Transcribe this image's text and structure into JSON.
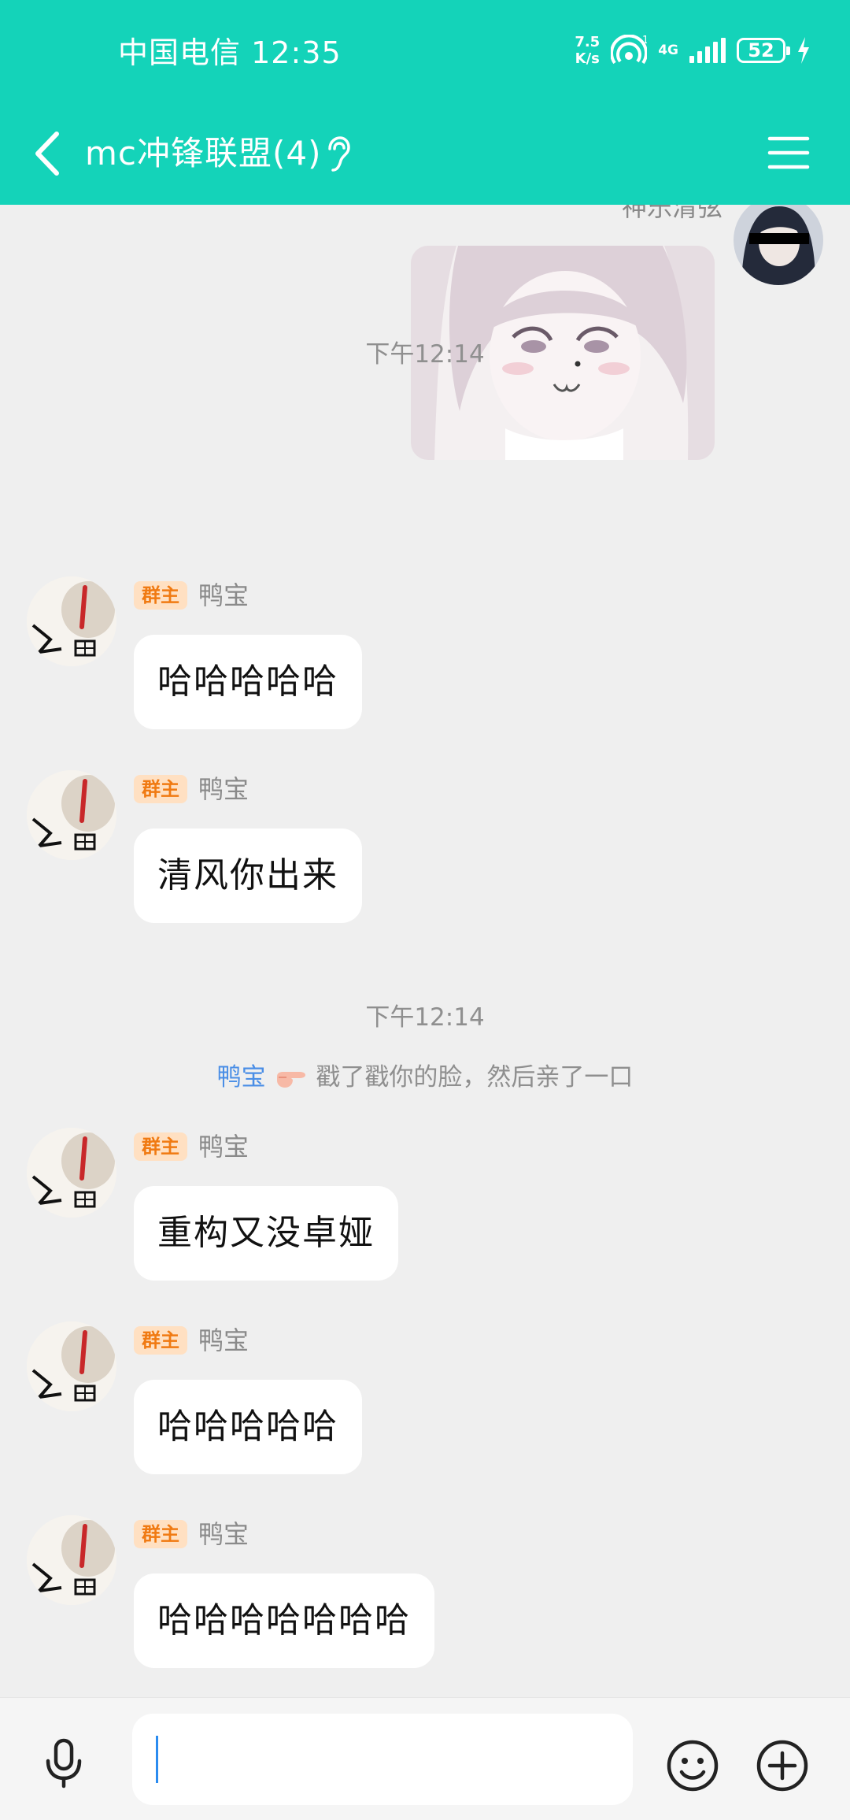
{
  "status_bar": {
    "carrier": "中国电信",
    "time": "12:35",
    "net_speed_value": "7.5",
    "net_speed_unit": "K/s",
    "network_type": "4G",
    "battery": "52"
  },
  "header": {
    "title": "mc冲锋联盟(4)"
  },
  "self_message": {
    "sender": "神乐清弦"
  },
  "messages": [
    {
      "time": "下午12:14"
    },
    {
      "badge": "群主",
      "sender": "鸭宝",
      "text": "哈哈哈哈哈"
    },
    {
      "badge": "群主",
      "sender": "鸭宝",
      "text": "清风你出来"
    },
    {
      "time": "下午12:14"
    },
    {
      "system_actor": "鸭宝",
      "system_text": "戳了戳你的脸，然后亲了一口"
    },
    {
      "badge": "群主",
      "sender": "鸭宝",
      "text": "重构又没卓娅"
    },
    {
      "badge": "群主",
      "sender": "鸭宝",
      "text": "哈哈哈哈哈"
    },
    {
      "badge": "群主",
      "sender": "鸭宝",
      "text": "哈哈哈哈哈哈哈"
    }
  ],
  "colors": {
    "header_bg": "#14d3b9",
    "chat_bg": "#efefef",
    "owner_badge_bg": "#ffe0c2",
    "owner_badge_text": "#f07a12",
    "system_name": "#4a8ee6",
    "caret": "#2b8cf0"
  },
  "icons": {
    "back": "chevron-left-icon",
    "ear": "ear-icon",
    "menu": "hamburger-menu-icon",
    "voice": "microphone-icon",
    "emoji": "smiley-face-icon",
    "more": "plus-circle-icon"
  }
}
